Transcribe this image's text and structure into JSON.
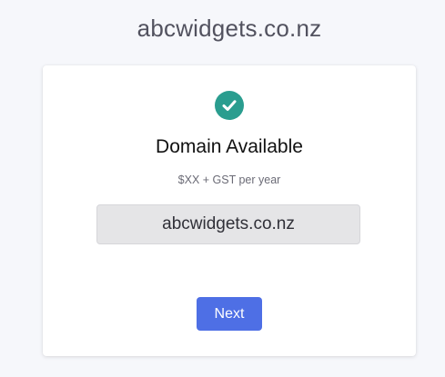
{
  "header": {
    "domain": "abcwidgets.co.nz"
  },
  "result": {
    "status_icon": "check-circle-icon",
    "status_color": "#2a9d8f",
    "heading": "Domain Available",
    "price": "$XX + GST per year",
    "domain": "abcwidgets.co.nz"
  },
  "actions": {
    "next_label": "Next",
    "next_color": "#4e6fe5"
  }
}
